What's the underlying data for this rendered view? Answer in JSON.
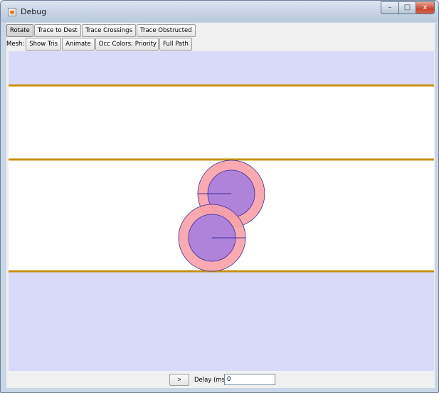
{
  "window": {
    "title": "Debug",
    "controls": {
      "minimize": "–",
      "maximize": "□",
      "close": "x"
    }
  },
  "toolbar_top": {
    "buttons": [
      {
        "label": "Rotate",
        "pressed": true
      },
      {
        "label": "Trace to Dest",
        "pressed": false
      },
      {
        "label": "Trace Crossings",
        "pressed": false
      },
      {
        "label": "Trace Obstructed",
        "pressed": false
      }
    ]
  },
  "toolbar_mesh": {
    "mesh_label": "Mesh:",
    "show_tris": "Show Tris",
    "animate": "Animate",
    "occ_colors_label": "Occ Colors:",
    "priority": "Priority",
    "full_path": "Full Path"
  },
  "scene": {
    "colors": {
      "region": "#d9dafa",
      "walkable": "#ffffff",
      "boundary": "#c8920f",
      "agent_outer": "#f8a2a9",
      "agent_inner": "#ae83d9",
      "agent_outline": "#3e2d9a"
    },
    "agents": [
      {
        "name": "agent-upper"
      },
      {
        "name": "agent-lower"
      }
    ]
  },
  "statusbar": {
    "step_label": ">",
    "delay_label": "Delay (ms):",
    "delay_value": "0"
  }
}
